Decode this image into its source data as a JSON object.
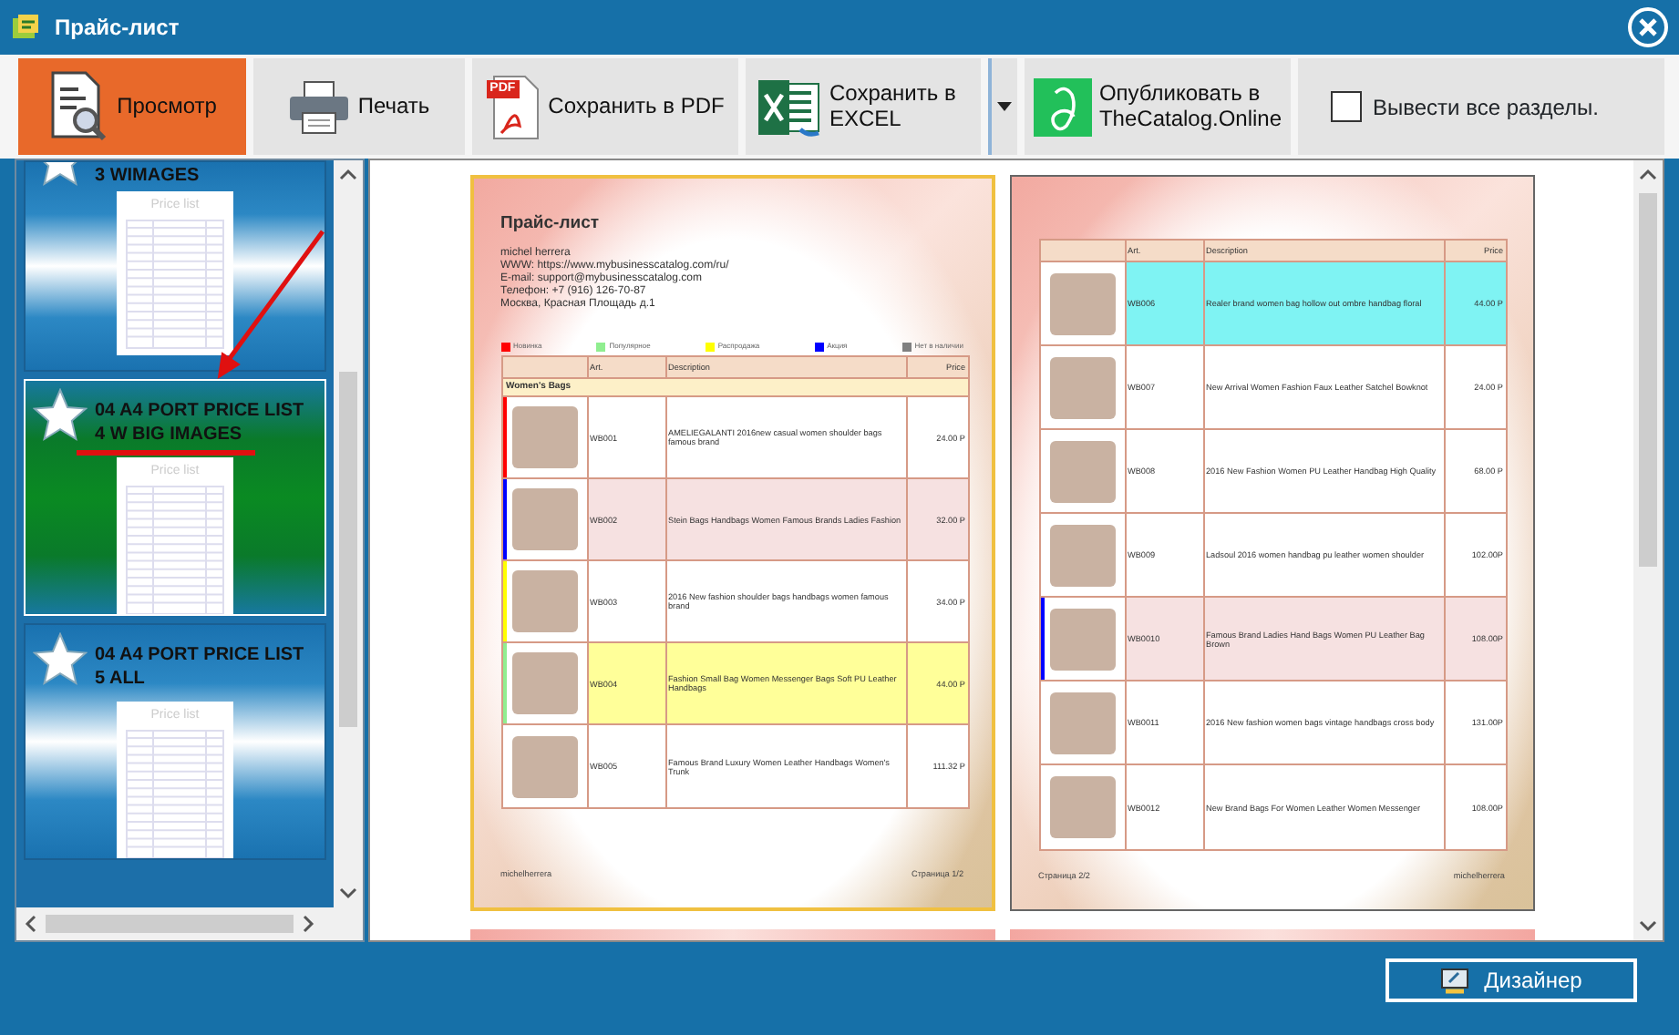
{
  "window": {
    "title": "Прайс-лист"
  },
  "toolbar": {
    "buttons": [
      {
        "kind": "preview",
        "label": "Просмотр",
        "selected": true
      },
      {
        "kind": "print",
        "label": "Печать",
        "selected": false
      },
      {
        "kind": "pdf",
        "label": "Сохранить в PDF",
        "badge": "PDF",
        "selected": false
      },
      {
        "kind": "excel",
        "label": "Сохранить в EXCEL",
        "selected": false,
        "has_menu": true
      },
      {
        "kind": "publish",
        "label": "Опубликовать в TheCatalog.Online",
        "selected": false
      }
    ],
    "checkbox": {
      "label": "Вывести все разделы.",
      "checked": false
    }
  },
  "templates": [
    {
      "title": "3 WIMAGES",
      "thumbnail": "Price list",
      "selected": false
    },
    {
      "title": "04 A4 PORT PRICE LIST 4 W BIG IMAGES",
      "thumbnail": "Price list",
      "selected": true
    },
    {
      "title": "04 A4 PORT PRICE LIST 5 ALL",
      "thumbnail": "Price list",
      "selected": false
    }
  ],
  "legend": [
    {
      "label": "Новинка",
      "color": "#ff0000"
    },
    {
      "label": "Популярное",
      "color": "#90ee90"
    },
    {
      "label": "Распродажа",
      "color": "#ffff00"
    },
    {
      "label": "Акция",
      "color": "#0000ff"
    },
    {
      "label": "Нет в наличии",
      "color": "#808080"
    }
  ],
  "pages": [
    {
      "selected": true,
      "header": {
        "title": "Прайс-лист",
        "lines": [
          "michel herrera",
          "WWW: https://www.mybusinesscatalog.com/ru/",
          "E-mail: support@mybusinesscatalog.com",
          "Телефон: +7 (916) 126-70-87",
          "Москва, Красная Площадь д.1"
        ]
      },
      "columns": [
        "Art.",
        "Description",
        "Price"
      ],
      "group": "Women's Bags",
      "rows": [
        {
          "art": "WB001",
          "description": "AMELIEGALANTI 2016new casual women shoulder bags famous brand",
          "price": "24.00 Р",
          "marker": {
            "color": "#ff0000"
          }
        },
        {
          "art": "WB002",
          "description": "Stein Bags Handbags Women Famous Brands Ladies Fashion",
          "price": "32.00 Р",
          "marker": {
            "color": "#0000ff"
          },
          "color": "#f6e1e1"
        },
        {
          "art": "WB003",
          "description": "2016 New fashion shoulder bags handbags women famous brand",
          "price": "34.00 Р",
          "marker": {
            "color": "#ffff00"
          }
        },
        {
          "art": "WB004",
          "description": "Fashion Small Bag Women Messenger Bags Soft PU Leather Handbags",
          "price": "44.00 Р",
          "marker": {
            "color": "#90ee90"
          },
          "color": "#ffff99"
        },
        {
          "art": "WB005",
          "description": "Famous Brand Luxury Women Leather Handbags Women's Trunk",
          "price": "111.32 Р"
        }
      ],
      "footer": [
        "michelherrera",
        "Страница 1/2"
      ]
    },
    {
      "selected": false,
      "columns": [
        "Art.",
        "Description",
        "Price"
      ],
      "rows": [
        {
          "art": "WB006",
          "description": "Realer brand women bag hollow out ombre handbag floral",
          "price": "44.00 Р",
          "color": "#7ff3f3"
        },
        {
          "art": "WB007",
          "description": "New Arrival Women Fashion Faux Leather Satchel Bowknot",
          "price": "24.00 Р"
        },
        {
          "art": "WB008",
          "description": "2016 New Fashion Women PU Leather Handbag High Quality",
          "price": "68.00 Р"
        },
        {
          "art": "WB009",
          "description": "Ladsoul 2016 women handbag pu leather women shoulder",
          "price": "102.00Р"
        },
        {
          "art": "WB0010",
          "description": "Famous Brand Ladies Hand Bags Women PU Leather Bag Brown",
          "price": "108.00Р",
          "marker": {
            "color": "#0000ff"
          },
          "color": "#f6e1e1"
        },
        {
          "art": "WB0011",
          "description": "2016 New fashion women bags vintage handbags cross body",
          "price": "131.00Р"
        },
        {
          "art": "WB0012",
          "description": "New Brand Bags For Women Leather Women Messenger",
          "price": "108.00Р"
        }
      ],
      "footer": [
        "Страница 2/2",
        "michelherrera"
      ]
    }
  ],
  "footer": {
    "button": "Дизайнер"
  }
}
